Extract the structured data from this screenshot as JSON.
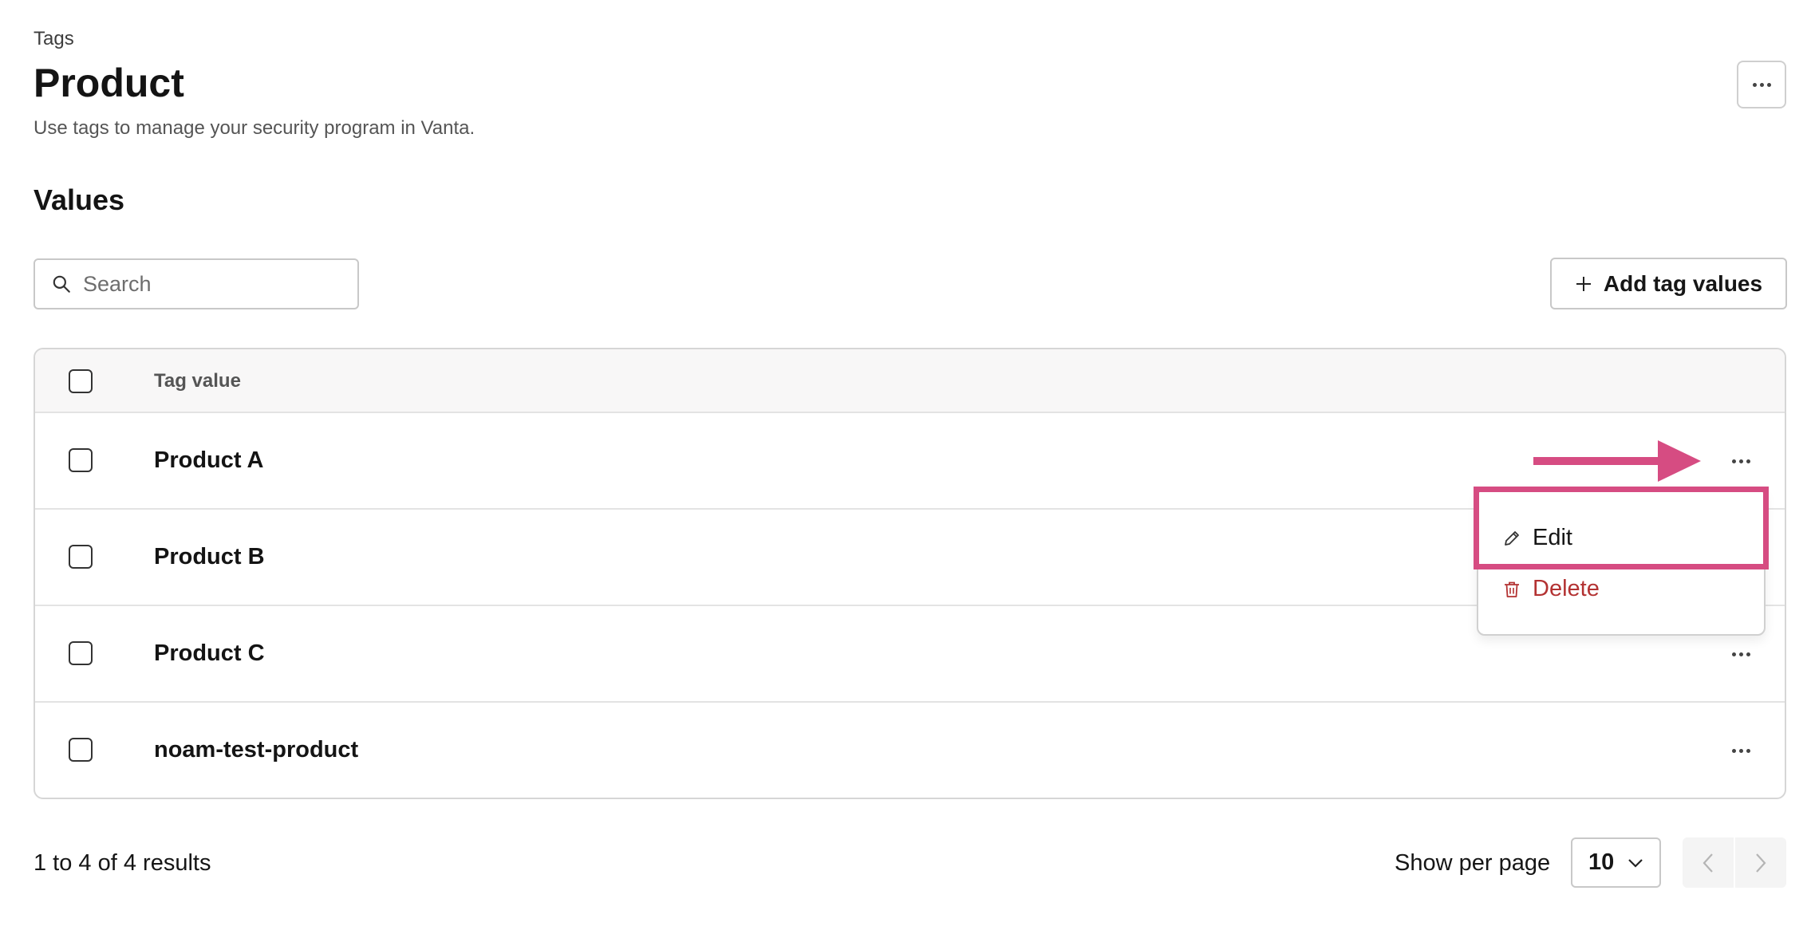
{
  "header": {
    "breadcrumb": "Tags",
    "title": "Product",
    "description": "Use tags to manage your security program in Vanta."
  },
  "values_section": {
    "heading": "Values",
    "search": {
      "placeholder": "Search",
      "value": ""
    },
    "add_button_label": "Add tag values"
  },
  "table": {
    "column_header": "Tag value",
    "rows": [
      {
        "value": "Product A"
      },
      {
        "value": "Product B"
      },
      {
        "value": "Product C"
      },
      {
        "value": "noam-test-product"
      }
    ]
  },
  "row_menu": {
    "edit_label": "Edit",
    "delete_label": "Delete"
  },
  "footer": {
    "results_text": "1 to 4 of 4 results",
    "per_page_label": "Show per page",
    "per_page_value": "10"
  },
  "colors": {
    "annotation": "#d64c82",
    "danger": "#b33232"
  },
  "icons": {
    "search": "search-icon",
    "add": "plus-icon",
    "more": "more-horizontal-icon",
    "edit": "pencil-icon",
    "delete": "trash-icon",
    "select": "chevron-down-icon",
    "prev": "chevron-left-icon",
    "next": "chevron-right-icon"
  }
}
